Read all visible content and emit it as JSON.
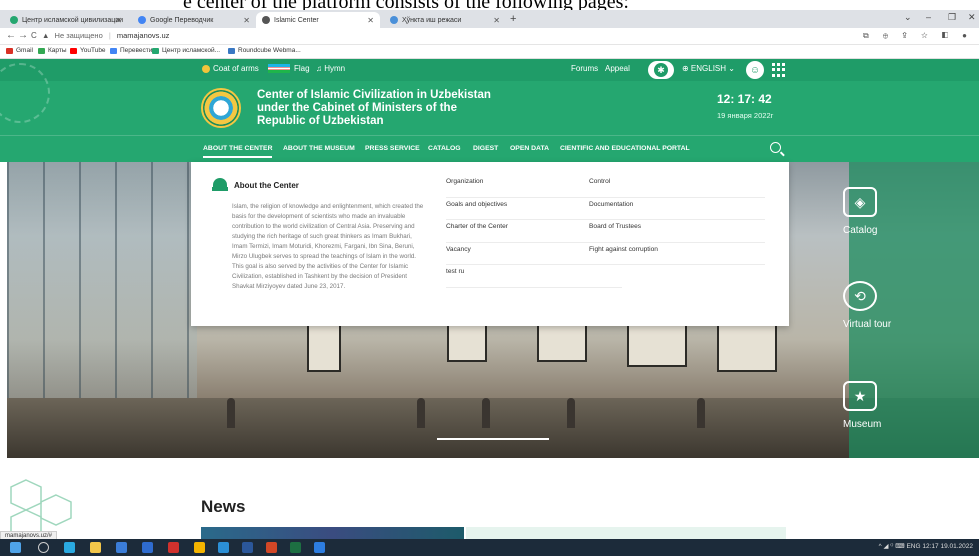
{
  "doc_caption": "e center of the platform consists of the following pages:",
  "browser": {
    "tabs": [
      {
        "title": "Центр исламской цивилизации",
        "icon_color": "#25a770"
      },
      {
        "title": "Google Переводчик",
        "icon_color": "#4285f4"
      },
      {
        "title": "Islamic Center",
        "icon_color": "#555555"
      },
      {
        "title": "Ҳўнкта иш режаси",
        "icon_color": "#4a90d9"
      }
    ],
    "new_tab": "+",
    "window_controls": [
      "⌄",
      "–",
      "❐",
      "✕"
    ],
    "nav": {
      "back": "←",
      "forward": "→",
      "reload": "C"
    },
    "url": {
      "warning": "▲",
      "not_secure": "Не защищено",
      "host": "mamajanovs.uz"
    },
    "toolbar_icons": "⧉ ⊕ ⇪ ☆ ◧ ●",
    "bookmarks": [
      {
        "label": "Gmail",
        "color": "#d93025"
      },
      {
        "label": "Карты",
        "color": "#34a853"
      },
      {
        "label": "YouTube",
        "color": "#ff0000"
      },
      {
        "label": "Перевести",
        "color": "#4285f4"
      },
      {
        "label": "Центр исламской...",
        "color": "#25a770"
      },
      {
        "label": "Roundcube Webma...",
        "color": "#3a78c3"
      }
    ]
  },
  "topnav": {
    "coat_of_arms": "Coat of arms",
    "flag": "Flag",
    "hymn": "♫ Hymn",
    "forums": "Forums",
    "appeal": "Appeal",
    "language": "⊕ ENGLISH ⌄",
    "accessibility_icon": "accessibility-icon",
    "user_icon": "user-icon",
    "apps_icon": "apps-grid-icon"
  },
  "header": {
    "org_name": "Center of Islamic Civilization in Uzbekistan under the Cabinet of Ministers of the Republic of Uzbekistan",
    "time": "12: 17: 42",
    "date": "19 января 2022г"
  },
  "mainnav": [
    "ABOUT THE CENTER",
    "ABOUT THE MUSEUM",
    "PRESS SERVICE",
    "CATALOG",
    "DIGEST",
    "OPEN DATA",
    "CIENTIFIC AND EDUCATIONAL PORTAL"
  ],
  "dropdown": {
    "about_title": "About the Center",
    "about_text": "Islam, the religion of knowledge and enlightenment, which created the basis for the development of scientists who made an invaluable contribution to the world civilization of Central Asia. Preserving and studying the rich heritage of such great thinkers as Imam Bukhari, Imam Termizi, Imam Moturidi, Khorezmi, Fargani, Ibn Sina, Beruni, Mirzo Ulugbek serves to spread the teachings of Islam in the world. This goal is also served by the activities of the Center for Islamic Civilization, established in Tashkent by the decision of President Shavkat Mirziyoyev dated June 23, 2017.",
    "col1": [
      "Organization",
      "Goals and objectives",
      "Charter of the Center",
      "Vacancy",
      "test ru"
    ],
    "col2": [
      "Control",
      "Documentation",
      "Board of Trustees",
      "Fight against corruption"
    ]
  },
  "side_menu": [
    {
      "label": "Catalog",
      "icon": "layers-icon"
    },
    {
      "label": "Virtual tour",
      "icon": "virtual-tour-icon"
    },
    {
      "label": "Museum",
      "icon": "museum-ticket-icon"
    }
  ],
  "news": {
    "title": "News"
  },
  "status_url": "mamajanovs.uz/#",
  "taskbar": {
    "tray": "^ ◢ ⁽⁾ ⌨ ENG",
    "clock_time": "12:17",
    "clock_date": "19.01.2022"
  },
  "colors": {
    "brand": "#25a770",
    "brand_dark": "#1f9c68"
  }
}
